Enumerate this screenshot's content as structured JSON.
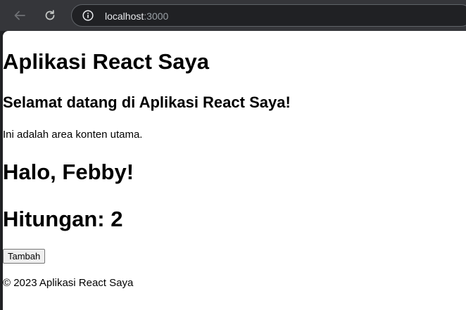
{
  "browser": {
    "url_host": "localhost",
    "url_port": ":3000",
    "icons": {
      "back": "arrow-left-icon",
      "reload": "reload-icon",
      "info": "info-icon"
    },
    "colors": {
      "toolbar_bg": "#35363a",
      "omnibox_bg": "#202124",
      "url_host": "#e8eaed",
      "url_port": "#9aa0a6"
    }
  },
  "page": {
    "app_title": "Aplikasi React Saya",
    "welcome_heading": "Selamat datang di Aplikasi React Saya!",
    "main_text": "Ini adalah area konten utama.",
    "greeting": "Halo, Febby!",
    "counter_label": "Hitungan: ",
    "counter_value": "2",
    "add_button_label": "Tambah",
    "footer_text": "© 2023 Aplikasi React Saya"
  }
}
